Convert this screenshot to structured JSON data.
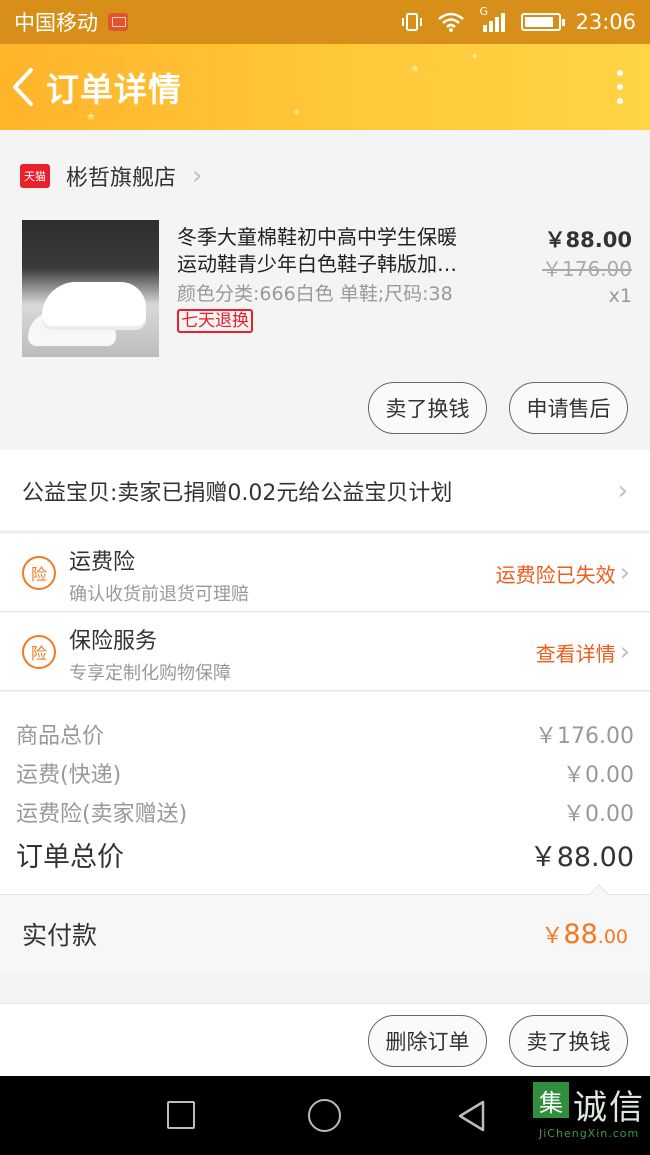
{
  "status_bar": {
    "carrier": "中国移动",
    "network": "G",
    "time": "23:06"
  },
  "nav": {
    "title": "订单详情"
  },
  "shop": {
    "logo_text": "天猫",
    "name": "彬哲旗舰店"
  },
  "product": {
    "title_line1": "冬季大童棉鞋初中高中学生保暖",
    "title_line2": "运动鞋青少年白色鞋子韩版加…",
    "spec": "颜色分类:666白色 单鞋;尺码:38",
    "badge": "七天退换",
    "price": "￥88.00",
    "original_price": "￥176.00",
    "quantity": "x1",
    "buttons": [
      "卖了换钱",
      "申请售后"
    ]
  },
  "charity": {
    "text": "公益宝贝:卖家已捐赠0.02元给公益宝贝计划"
  },
  "insurance": [
    {
      "icon_text": "险",
      "title": "运费险",
      "subtitle": "确认收货前退货可理赔",
      "value": "运费险已失效"
    },
    {
      "icon_text": "险",
      "title": "保险服务",
      "subtitle": "专享定制化购物保障",
      "value": "查看详情"
    }
  ],
  "totals": {
    "rows": [
      {
        "label": "商品总价",
        "value": "￥176.00"
      },
      {
        "label": "运费(快递)",
        "value": "￥0.00"
      },
      {
        "label": "运费险(卖家赠送)",
        "value": "￥0.00"
      }
    ],
    "order_total_label": "订单总价",
    "order_total_value": "￥88.00"
  },
  "paid": {
    "label": "实付款",
    "currency": "￥",
    "integer": "88",
    "decimal": ".00"
  },
  "bottom_actions": [
    "删除订单",
    "卖了换钱"
  ],
  "watermark": {
    "box_char": "集",
    "text": "诚信",
    "sub": "JiChengXin.com"
  },
  "colors": {
    "status_bar": "#d88f1a",
    "nav_gradient_start": "#ffb42a",
    "accent_orange": "#f47920",
    "tmall_red": "#e8202b"
  }
}
